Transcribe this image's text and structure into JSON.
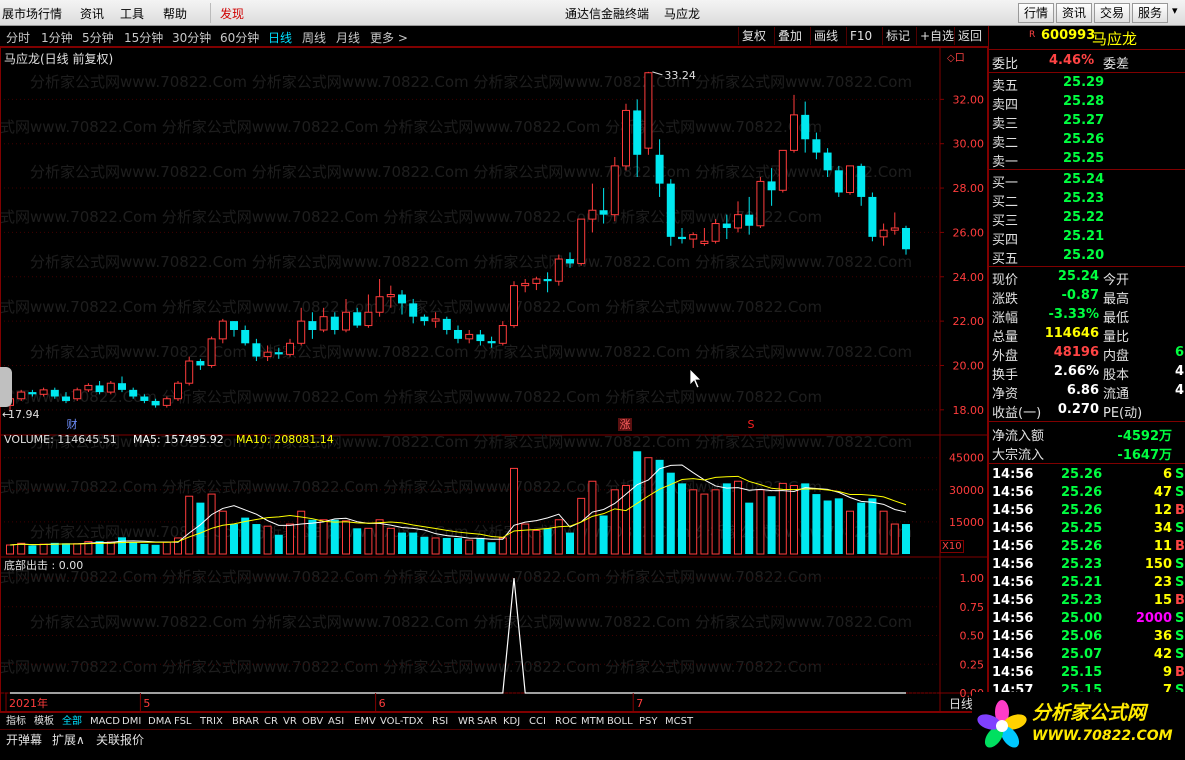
{
  "menu": {
    "items": [
      "展市场行情",
      "资讯",
      "工具",
      "帮助"
    ],
    "discover": "发现",
    "title": "通达信金融终端",
    "stock_title": "马应龙",
    "right_buttons": [
      "行情",
      "资讯",
      "交易",
      "服务"
    ]
  },
  "toolbar": {
    "periods": [
      "分时",
      "1分钟",
      "5分钟",
      "15分钟",
      "30分钟",
      "60分钟",
      "日线",
      "周线",
      "月线",
      "更多 >"
    ],
    "active_period": "日线",
    "tools": [
      "复权",
      "叠加",
      "画线",
      "F10",
      "标记",
      "+自选",
      "返回"
    ]
  },
  "chart": {
    "title": "马应龙(日线 前复权)",
    "watermark": "分析家公式网www.70822.Com",
    "max_label": "33.24",
    "min_label": "17.94",
    "badge_cai": "财",
    "badge_zhang": "涨",
    "badge_s": "S",
    "volume_label": "VOLUME: 114645.51",
    "ma5_label": "MA5: 157495.92",
    "ma10_label": "MA10: 208081.14",
    "x10_label": "X10",
    "indicator_label": "底部出击 : 0.00",
    "dates": [
      "2021年",
      "5",
      "6",
      "7"
    ],
    "period_tag": "日线"
  },
  "chart_data": {
    "type": "candlestick",
    "price_axis": [
      18.0,
      20.0,
      22.0,
      24.0,
      26.0,
      28.0,
      30.0,
      32.0
    ],
    "volume_axis": [
      15000,
      30000,
      45000
    ],
    "indicator_axis": [
      0.0,
      0.25,
      0.5,
      0.75,
      1.0
    ],
    "ylim": [
      17.0,
      34.0
    ],
    "candles": [
      [
        18.2,
        18.5,
        18.0,
        18.6
      ],
      [
        18.5,
        18.8,
        18.4,
        18.9
      ],
      [
        18.8,
        18.7,
        18.6,
        18.9
      ],
      [
        18.7,
        18.9,
        18.6,
        19.0
      ],
      [
        18.9,
        18.6,
        18.5,
        19.0
      ],
      [
        18.6,
        18.4,
        18.3,
        18.8
      ],
      [
        18.5,
        18.9,
        18.4,
        19.0
      ],
      [
        18.9,
        19.1,
        18.8,
        19.2
      ],
      [
        19.1,
        18.8,
        18.7,
        19.3
      ],
      [
        18.8,
        19.2,
        18.7,
        19.3
      ],
      [
        19.2,
        18.9,
        18.8,
        19.5
      ],
      [
        18.9,
        18.6,
        18.5,
        19.0
      ],
      [
        18.6,
        18.4,
        18.3,
        18.7
      ],
      [
        18.4,
        18.2,
        18.1,
        18.5
      ],
      [
        18.2,
        18.5,
        18.1,
        18.6
      ],
      [
        18.5,
        19.2,
        18.4,
        19.3
      ],
      [
        19.2,
        20.2,
        19.1,
        20.4
      ],
      [
        20.2,
        20.0,
        19.8,
        20.3
      ],
      [
        20.0,
        21.2,
        19.9,
        21.3
      ],
      [
        21.2,
        22.0,
        21.0,
        22.1
      ],
      [
        22.0,
        21.6,
        21.3,
        22.0
      ],
      [
        21.6,
        21.0,
        20.9,
        21.8
      ],
      [
        21.0,
        20.4,
        20.2,
        21.2
      ],
      [
        20.4,
        20.6,
        20.2,
        20.9
      ],
      [
        20.6,
        20.5,
        20.3,
        20.8
      ],
      [
        20.5,
        21.0,
        20.4,
        21.2
      ],
      [
        21.0,
        22.0,
        20.9,
        22.6
      ],
      [
        22.0,
        21.6,
        21.2,
        22.4
      ],
      [
        21.6,
        22.2,
        21.5,
        22.6
      ],
      [
        22.2,
        21.6,
        21.4,
        22.4
      ],
      [
        21.6,
        22.4,
        21.5,
        23.0
      ],
      [
        22.4,
        21.8,
        21.7,
        22.6
      ],
      [
        21.8,
        22.4,
        21.7,
        23.2
      ],
      [
        22.4,
        23.1,
        22.2,
        23.9
      ],
      [
        23.1,
        23.2,
        22.6,
        23.6
      ],
      [
        23.2,
        22.8,
        22.3,
        23.4
      ],
      [
        22.8,
        22.2,
        21.9,
        23.0
      ],
      [
        22.2,
        22.0,
        21.8,
        22.3
      ],
      [
        22.0,
        22.1,
        21.7,
        22.4
      ],
      [
        22.1,
        21.6,
        21.4,
        22.2
      ],
      [
        21.6,
        21.2,
        21.0,
        21.8
      ],
      [
        21.2,
        21.4,
        21.0,
        21.6
      ],
      [
        21.4,
        21.1,
        20.9,
        21.6
      ],
      [
        21.1,
        21.0,
        20.8,
        21.3
      ],
      [
        21.0,
        21.8,
        20.9,
        22.0
      ],
      [
        21.8,
        23.6,
        21.7,
        23.8
      ],
      [
        23.6,
        23.7,
        23.3,
        23.9
      ],
      [
        23.7,
        23.9,
        23.4,
        24.0
      ],
      [
        23.9,
        23.8,
        23.3,
        24.2
      ],
      [
        23.8,
        24.8,
        23.6,
        25.0
      ],
      [
        24.8,
        24.6,
        24.4,
        25.1
      ],
      [
        24.6,
        26.6,
        24.5,
        26.6
      ],
      [
        26.6,
        27.0,
        26.0,
        28.2
      ],
      [
        27.0,
        26.8,
        26.4,
        28.0
      ],
      [
        26.8,
        29.0,
        26.5,
        29.4
      ],
      [
        29.0,
        31.5,
        28.8,
        31.8
      ],
      [
        31.5,
        29.5,
        28.5,
        32.0
      ],
      [
        29.8,
        33.2,
        29.5,
        33.24
      ],
      [
        29.5,
        28.2,
        27.6,
        30.2
      ],
      [
        28.2,
        25.8,
        25.4,
        28.4
      ],
      [
        25.8,
        25.7,
        25.5,
        26.2
      ],
      [
        25.7,
        25.9,
        25.3,
        26.0
      ],
      [
        25.5,
        25.6,
        25.4,
        26.2
      ],
      [
        25.6,
        26.4,
        25.5,
        26.6
      ],
      [
        26.4,
        26.2,
        25.7,
        26.8
      ],
      [
        26.2,
        26.8,
        26.0,
        27.4
      ],
      [
        26.8,
        26.3,
        25.9,
        27.6
      ],
      [
        26.3,
        28.3,
        26.2,
        28.5
      ],
      [
        28.3,
        27.9,
        27.2,
        28.9
      ],
      [
        27.9,
        29.7,
        27.8,
        29.7
      ],
      [
        29.7,
        31.3,
        29.6,
        32.2
      ],
      [
        31.3,
        30.2,
        29.6,
        31.9
      ],
      [
        30.2,
        29.6,
        29.3,
        30.5
      ],
      [
        29.6,
        28.8,
        28.5,
        29.8
      ],
      [
        28.8,
        27.8,
        27.6,
        29.0
      ],
      [
        27.8,
        29.0,
        27.7,
        29.0
      ],
      [
        29.0,
        27.6,
        27.2,
        29.1
      ],
      [
        27.6,
        25.8,
        25.6,
        27.8
      ],
      [
        25.8,
        26.1,
        25.4,
        26.4
      ],
      [
        26.1,
        26.2,
        25.9,
        26.9
      ],
      [
        26.2,
        25.24,
        25.0,
        26.3
      ]
    ],
    "volumes": [
      4200,
      5000,
      4000,
      4600,
      5200,
      5000,
      4800,
      5800,
      6000,
      5600,
      7800,
      5600,
      4700,
      4300,
      5500,
      7500,
      27000,
      24000,
      28000,
      20000,
      14000,
      17000,
      14000,
      13000,
      9000,
      14000,
      20000,
      16000,
      16000,
      16000,
      15500,
      12000,
      12000,
      16000,
      12000,
      10000,
      10000,
      8000,
      7500,
      7500,
      7500,
      6500,
      7500,
      5500,
      7500,
      40000,
      14000,
      11000,
      12000,
      16000,
      10000,
      26000,
      34000,
      18000,
      30000,
      32000,
      48000,
      45000,
      44000,
      38000,
      33000,
      30000,
      28000,
      30000,
      33000,
      34000,
      24000,
      30000,
      27000,
      33000,
      32000,
      33000,
      28000,
      25000,
      26000,
      20000,
      24000,
      26000,
      20000,
      14000,
      14000
    ],
    "indicator": {
      "name": "底部出击",
      "values": [
        0,
        0,
        0,
        0,
        0,
        0,
        0,
        0,
        0,
        0,
        0,
        0,
        0,
        0,
        0,
        0,
        0,
        0,
        0,
        0,
        0,
        0,
        0,
        0,
        0,
        0,
        0,
        0,
        0,
        0,
        0,
        0,
        0,
        0,
        0,
        0,
        0,
        0,
        0,
        0,
        0,
        0,
        0,
        0,
        0,
        1,
        0,
        0,
        0,
        0,
        0,
        0,
        0,
        0,
        0,
        0,
        0,
        0,
        0,
        0,
        0,
        0,
        0,
        0,
        0,
        0,
        0,
        0,
        0,
        0,
        0,
        0,
        0,
        0,
        0,
        0,
        0,
        0,
        0,
        0,
        0
      ]
    }
  },
  "side": {
    "code": "600993",
    "name": "马应龙",
    "r_mark": "R",
    "webi_label": "委比",
    "webi_value": "4.46%",
    "wecha_label": "委差",
    "asks": [
      {
        "label": "卖五",
        "price": "25.29"
      },
      {
        "label": "卖四",
        "price": "25.28"
      },
      {
        "label": "卖三",
        "price": "25.27"
      },
      {
        "label": "卖二",
        "price": "25.26"
      },
      {
        "label": "卖一",
        "price": "25.25"
      }
    ],
    "bids": [
      {
        "label": "买一",
        "price": "25.24"
      },
      {
        "label": "买二",
        "price": "25.23"
      },
      {
        "label": "买三",
        "price": "25.22"
      },
      {
        "label": "买四",
        "price": "25.21"
      },
      {
        "label": "买五",
        "price": "25.20"
      }
    ],
    "stats": [
      {
        "l1": "现价",
        "v1": "25.24",
        "c1": "green",
        "l2": "今开"
      },
      {
        "l1": "涨跌",
        "v1": "-0.87",
        "c1": "green",
        "l2": "最高"
      },
      {
        "l1": "涨幅",
        "v1": "-3.33%",
        "c1": "green",
        "l2": "最低"
      },
      {
        "l1": "总量",
        "v1": "114646",
        "c1": "yellow",
        "l2": "量比"
      },
      {
        "l1": "外盘",
        "v1": "48196",
        "c1": "red",
        "l2": "内盘",
        "v2": "6",
        "c2": "green"
      },
      {
        "l1": "换手",
        "v1": "2.66%",
        "c1": "white",
        "l2": "股本",
        "v2": "4",
        "c2": "white"
      },
      {
        "l1": "净资",
        "v1": "6.86",
        "c1": "white",
        "l2": "流通",
        "v2": "4",
        "c2": "white"
      },
      {
        "l1": "收益(一)",
        "v1": "0.270",
        "c1": "white",
        "l2": "PE(动)"
      }
    ],
    "flow": [
      {
        "label": "净流入额",
        "value": "-4592万"
      },
      {
        "label": "大宗流入",
        "value": "-1647万"
      }
    ],
    "ticks": [
      {
        "t": "14:56",
        "p": "25.26",
        "v": "6",
        "vc": "yellow",
        "s": "S"
      },
      {
        "t": "14:56",
        "p": "25.26",
        "v": "47",
        "vc": "yellow",
        "s": "S"
      },
      {
        "t": "14:56",
        "p": "25.26",
        "v": "12",
        "vc": "yellow",
        "s": "B"
      },
      {
        "t": "14:56",
        "p": "25.25",
        "v": "34",
        "vc": "yellow",
        "s": "S"
      },
      {
        "t": "14:56",
        "p": "25.26",
        "v": "11",
        "vc": "yellow",
        "s": "B"
      },
      {
        "t": "14:56",
        "p": "25.23",
        "v": "150",
        "vc": "yellow",
        "s": "S"
      },
      {
        "t": "14:56",
        "p": "25.21",
        "v": "23",
        "vc": "yellow",
        "s": "S"
      },
      {
        "t": "14:56",
        "p": "25.23",
        "v": "15",
        "vc": "yellow",
        "s": "B"
      },
      {
        "t": "14:56",
        "p": "25.00",
        "v": "2000",
        "vc": "magenta",
        "s": "S"
      },
      {
        "t": "14:56",
        "p": "25.06",
        "v": "36",
        "vc": "yellow",
        "s": "S"
      },
      {
        "t": "14:56",
        "p": "25.07",
        "v": "42",
        "vc": "yellow",
        "s": "S"
      },
      {
        "t": "14:56",
        "p": "25.15",
        "v": "9",
        "vc": "yellow",
        "s": "B"
      },
      {
        "t": "14:57",
        "p": "25.15",
        "v": "7",
        "vc": "yellow",
        "s": "S"
      }
    ]
  },
  "indicator_tabs": [
    "指标",
    "模板",
    "全部",
    "MACD",
    "DMI",
    "DMA",
    "FSL",
    "TRIX",
    "BRAR",
    "CR",
    "VR",
    "OBV",
    "ASI",
    "EMV",
    "VOL-TDX",
    "RSI",
    "WR",
    "SAR",
    "KDJ",
    "CCI",
    "ROC",
    "MTM",
    "BOLL",
    "PSY",
    "MCST"
  ],
  "active_indicator_tab": "全部",
  "bottom_buttons": [
    "开弹幕",
    "扩展∧",
    "关联报价"
  ],
  "logo": {
    "text": "分析家公式网",
    "url": "WWW.70822.COM"
  },
  "colors": {
    "up": "#ff3c3c",
    "down": "#00e8f0",
    "ma5": "#ffffff",
    "ma10": "#ffff00",
    "grid": "#800000"
  }
}
